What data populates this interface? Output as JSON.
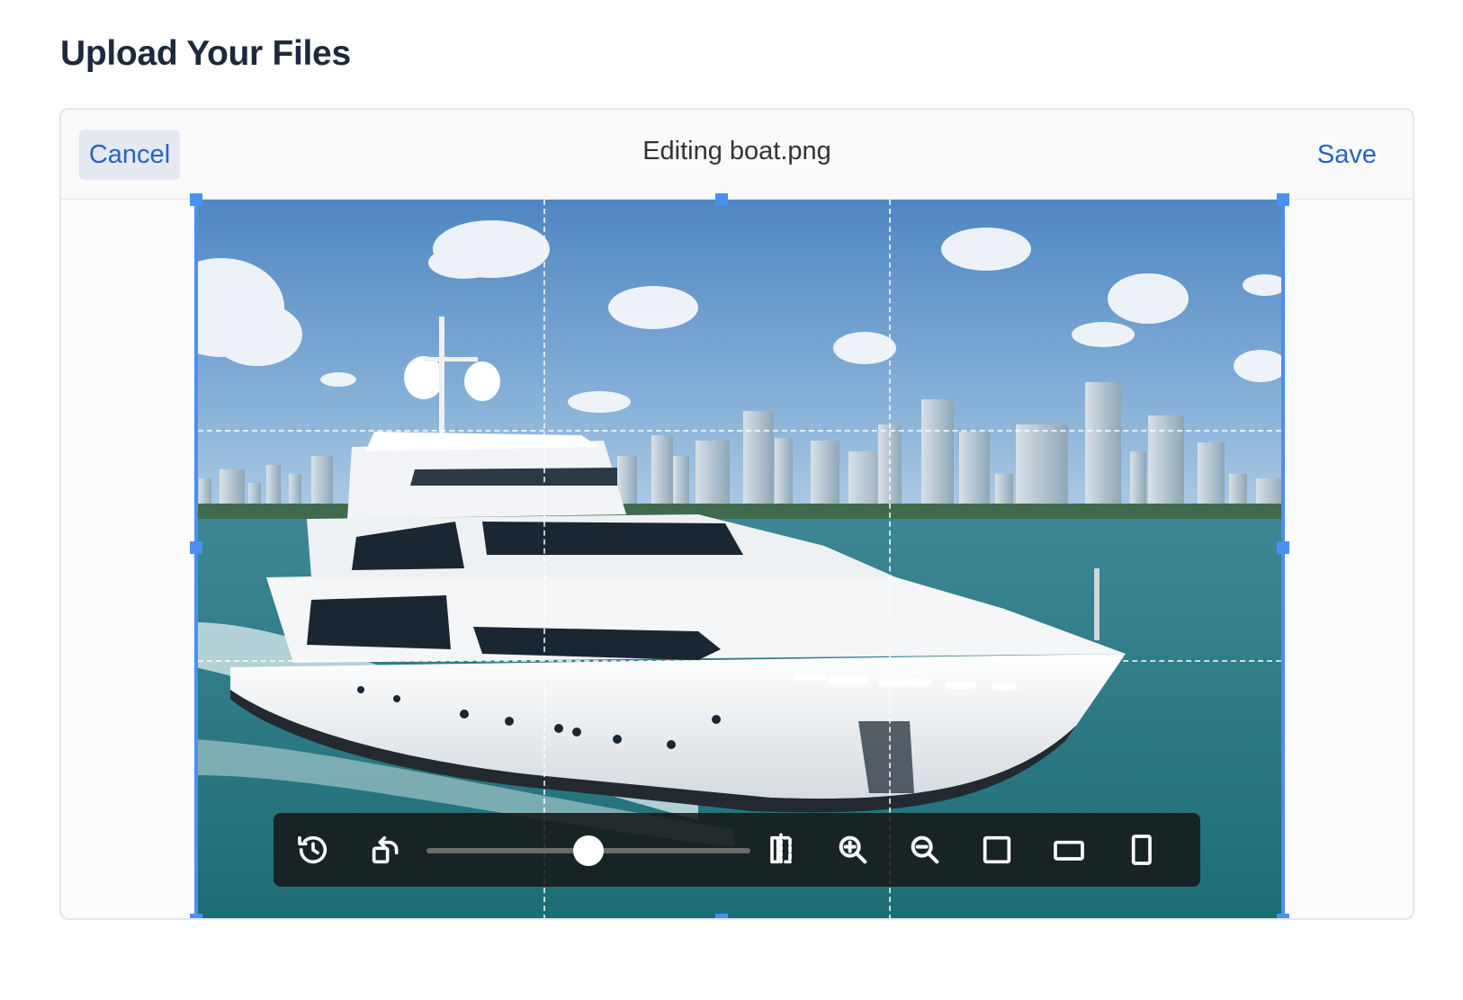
{
  "page": {
    "title": "Upload Your Files"
  },
  "editor": {
    "cancel_label": "Cancel",
    "title": "Editing boat.png",
    "save_label": "Save",
    "accent_color": "#4a90f0"
  },
  "toolbar": {
    "tools": [
      "revert-icon",
      "rotate-icon",
      "flip-horizontal-icon",
      "zoom-in-icon",
      "zoom-out-icon",
      "aspect-square-icon",
      "aspect-landscape-icon",
      "aspect-portrait-icon"
    ],
    "rotation_slider": {
      "value_fraction": 0.5
    }
  }
}
